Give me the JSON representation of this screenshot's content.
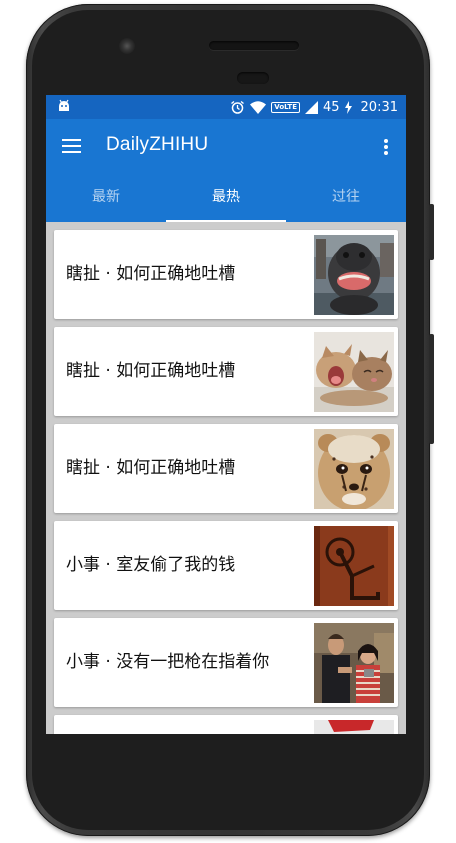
{
  "status_bar": {
    "volte": "VoLTE",
    "battery": "45",
    "time": "20:31"
  },
  "app_bar": {
    "title": "DailyZHIHU"
  },
  "tabs": [
    {
      "label": "最新",
      "active": false
    },
    {
      "label": "最热",
      "active": true
    },
    {
      "label": "过往",
      "active": false
    }
  ],
  "stories": [
    {
      "title": "瞎扯 · 如何正确地吐槽",
      "image": "dinosaur-statue"
    },
    {
      "title": "瞎扯 · 如何正确地吐槽",
      "image": "yawning-kittens"
    },
    {
      "title": "瞎扯 · 如何正确地吐槽",
      "image": "cheetah-cub"
    },
    {
      "title": "小事 · 室友偷了我的钱",
      "image": "bicycle-shadow"
    },
    {
      "title": "小事 · 没有一把枪在指着你",
      "image": "movie-scene"
    },
    {
      "title": "",
      "image": "partial-red"
    }
  ],
  "colors": {
    "primary": "#1976d2",
    "primary_dark": "#1565c0",
    "list_background": "#cccccc"
  }
}
